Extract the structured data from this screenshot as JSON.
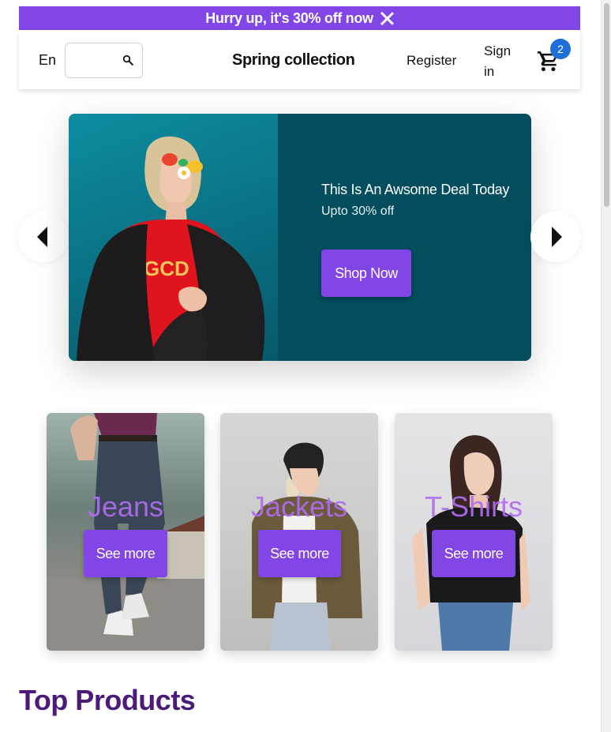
{
  "announcement": {
    "text": "Hurry up, it's 30% off now"
  },
  "header": {
    "language": "En",
    "search": {
      "value": "",
      "placeholder": ""
    },
    "brand": "Spring collection",
    "register_label": "Register",
    "signin_label": "Sign in",
    "cart_count": "2"
  },
  "hero": {
    "title": "This Is An Awsome Deal Today",
    "subtitle": "Upto 30% off",
    "button_label": "Shop Now"
  },
  "categories": [
    {
      "title": "Jeans",
      "button_label": "See more"
    },
    {
      "title": "Jackets",
      "button_label": "See more"
    },
    {
      "title": "T-Shirts",
      "button_label": "See more"
    }
  ],
  "section": {
    "title": "Top Products"
  },
  "colors": {
    "accent": "#8246e7",
    "hero_bg": "#024d5e",
    "badge": "#1e6fd9",
    "section_title": "#4b1a7a"
  },
  "icons": {
    "close": "close-icon",
    "search": "search-icon",
    "cart": "cart-icon",
    "prev": "chevron-left-icon",
    "next": "chevron-right-icon"
  }
}
